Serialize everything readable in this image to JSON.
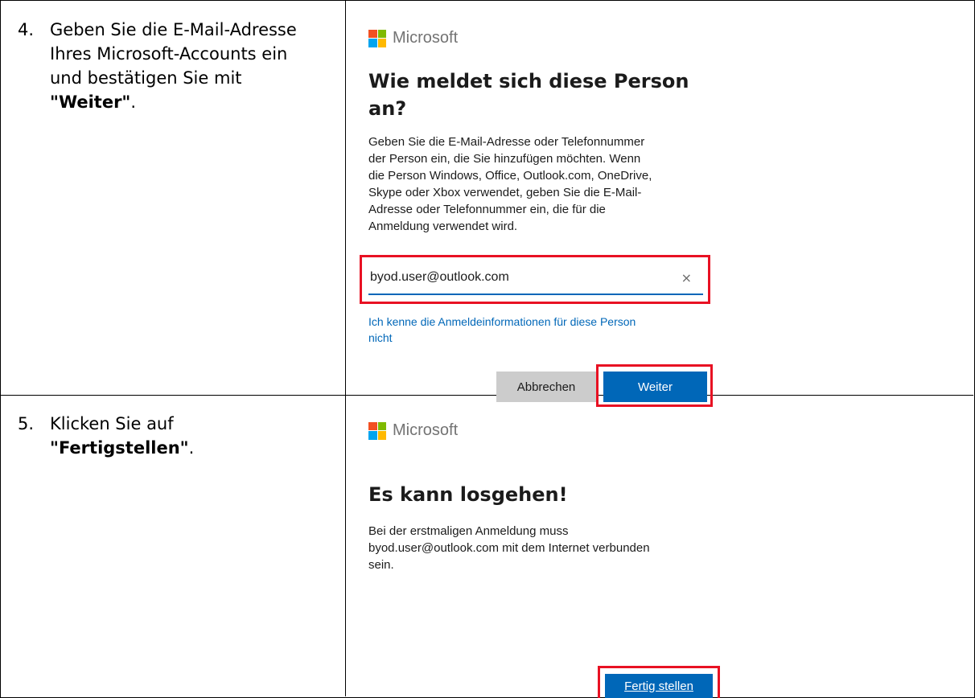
{
  "steps": [
    {
      "number": "4.",
      "line1": "Geben Sie die E-Mail-Adresse",
      "line2": "Ihres Microsoft-Accounts ein",
      "line3": "und bestätigen Sie mit",
      "bold": "\"Weiter\"",
      "suffix": "."
    },
    {
      "number": "5.",
      "line1": "Klicken Sie auf",
      "bold": "\"Fertigstellen\"",
      "suffix": "."
    }
  ],
  "dialog1": {
    "brand": "Microsoft",
    "title_line1": "Wie meldet sich diese Person",
    "title_line2": "an?",
    "description": [
      "Geben Sie die E-Mail-Adresse oder Telefonnummer",
      "der Person ein, die Sie hinzufügen möchten. Wenn",
      "die Person Windows, Office, Outlook.com, OneDrive,",
      "Skype oder Xbox verwendet, geben Sie die E-Mail-",
      "Adresse oder Telefonnummer ein, die für die",
      "Anmeldung verwendet wird."
    ],
    "email_value": "byod.user@outlook.com",
    "clear_icon": "×",
    "link_line1": "Ich kenne die Anmeldeinformationen für diese Person",
    "link_line2": "nicht",
    "cancel_label": "Abbrechen",
    "next_label": "Weiter"
  },
  "dialog2": {
    "brand": "Microsoft",
    "title": "Es kann losgehen!",
    "description": [
      "Bei der erstmaligen Anmeldung muss",
      "byod.user@outlook.com mit dem Internet verbunden",
      "sein."
    ],
    "finish_label": "Fertig stellen"
  },
  "colors": {
    "accent": "#0067b8",
    "highlight": "#e81123",
    "cancel_bg": "#cccccc"
  }
}
